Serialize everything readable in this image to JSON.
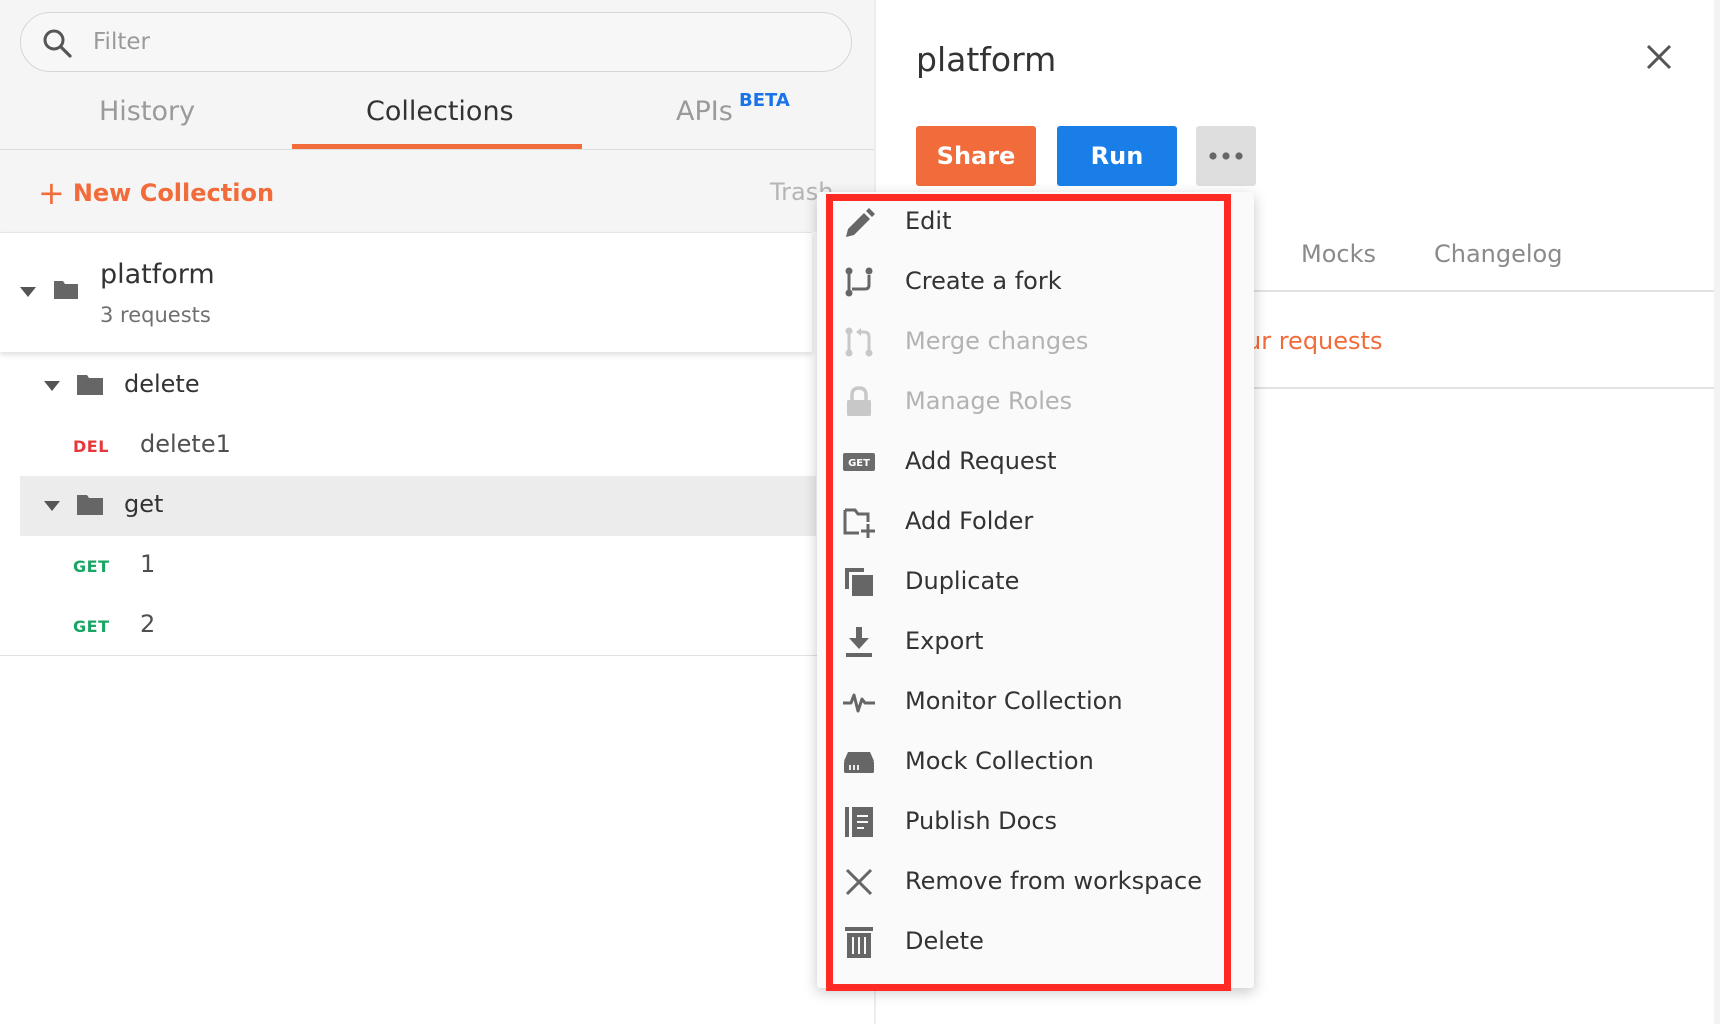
{
  "sidebar": {
    "filter_placeholder": "Filter",
    "tabs": {
      "history": "History",
      "collections": "Collections",
      "apis": "APIs",
      "apis_badge": "BETA"
    },
    "new_collection_label": "New Collection",
    "trash_label": "Trash",
    "collection": {
      "name": "platform",
      "count": "3 requests"
    },
    "tree": [
      {
        "type": "folder",
        "label": "delete"
      },
      {
        "type": "request",
        "method": "DEL",
        "label": "delete1"
      },
      {
        "type": "folder",
        "label": "get",
        "selected": true
      },
      {
        "type": "request",
        "method": "GET",
        "label": "1"
      },
      {
        "type": "request",
        "method": "GET",
        "label": "2"
      }
    ]
  },
  "panel": {
    "title": "platform",
    "share_label": "Share",
    "run_label": "Run",
    "tabs": [
      "Mocks",
      "Changelog"
    ],
    "link_text": "ur requests"
  },
  "menu": {
    "items": [
      {
        "label": "Edit",
        "icon": "pencil-icon",
        "enabled": true
      },
      {
        "label": "Create a fork",
        "icon": "fork-icon",
        "enabled": true
      },
      {
        "label": "Merge changes",
        "icon": "merge-icon",
        "enabled": false
      },
      {
        "label": "Manage Roles",
        "icon": "lock-icon",
        "enabled": false
      },
      {
        "label": "Add Request",
        "icon": "get-request-icon",
        "enabled": true
      },
      {
        "label": "Add Folder",
        "icon": "add-folder-icon",
        "enabled": true
      },
      {
        "label": "Duplicate",
        "icon": "duplicate-icon",
        "enabled": true
      },
      {
        "label": "Export",
        "icon": "download-icon",
        "enabled": true
      },
      {
        "label": "Monitor Collection",
        "icon": "pulse-icon",
        "enabled": true
      },
      {
        "label": "Mock Collection",
        "icon": "server-icon",
        "enabled": true
      },
      {
        "label": "Publish Docs",
        "icon": "docs-icon",
        "enabled": true
      },
      {
        "label": "Remove from workspace",
        "icon": "x-icon",
        "enabled": true
      },
      {
        "label": "Delete",
        "icon": "trash-icon",
        "enabled": true
      }
    ]
  },
  "colors": {
    "accent_orange": "#f26b3a",
    "run_blue": "#1a7ee8",
    "highlight_red": "#ff2a23",
    "method_del": "#e5383b",
    "method_get": "#1aa564"
  }
}
